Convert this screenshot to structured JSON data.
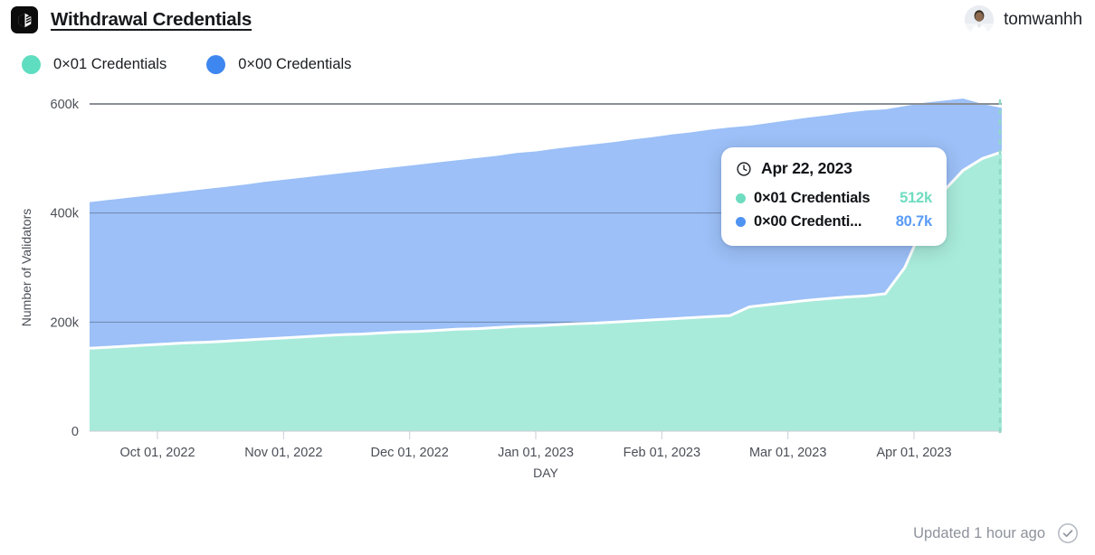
{
  "header": {
    "logo_icon": "cube-logo-icon",
    "title": "Withdrawal Credentials",
    "user": {
      "name": "tomwanhh",
      "avatar_icon": "user-avatar"
    }
  },
  "legend": {
    "items": [
      {
        "label": "0×01 Credentials",
        "color": "#5FDDC0",
        "icon": "legend-dot-icon"
      },
      {
        "label": "0×00 Credentials",
        "color": "#3E87F0",
        "icon": "legend-dot-icon"
      }
    ]
  },
  "tooltip": {
    "clock_icon": "clock-icon",
    "date": "Apr 22, 2023",
    "rows": [
      {
        "label": "0×01 Credentials",
        "value": "512k",
        "dot_color": "#6FDCC0",
        "value_color": "#6FDCC0"
      },
      {
        "label": "0×00 Credenti...",
        "value": "80.7k",
        "dot_color": "#4F93F3",
        "value_color": "#5B9CF5"
      }
    ]
  },
  "footer": {
    "updated_text": "Updated 1 hour ago",
    "status_icon": "check-circle-icon"
  },
  "chart_data": {
    "type": "area",
    "title": "Withdrawal Credentials",
    "xlabel": "DAY",
    "ylabel": "Number of Validators",
    "ylim": [
      0,
      600000
    ],
    "ytick_labels": [
      "0",
      "200k",
      "400k",
      "600k"
    ],
    "ytick_values": [
      0,
      200000,
      400000,
      600000
    ],
    "xtick_labels": [
      "Oct 01, 2022",
      "Nov 01, 2022",
      "Dec 01, 2022",
      "Jan 01, 2023",
      "Feb 01, 2023",
      "Mar 01, 2023",
      "Apr 01, 2023"
    ],
    "grid": true,
    "stacked": true,
    "legend_position": "top-left",
    "cursor": {
      "date": "Apr 22, 2023",
      "style": "dashed-vertical",
      "color": "#8FD9C6"
    },
    "x": [
      "2022-09-16",
      "2022-09-21",
      "2022-09-26",
      "2022-10-01",
      "2022-10-06",
      "2022-10-11",
      "2022-10-16",
      "2022-10-21",
      "2022-10-26",
      "2022-11-01",
      "2022-11-06",
      "2022-11-11",
      "2022-11-16",
      "2022-11-21",
      "2022-11-26",
      "2022-12-01",
      "2022-12-06",
      "2022-12-11",
      "2022-12-16",
      "2022-12-21",
      "2022-12-26",
      "2023-01-01",
      "2023-01-06",
      "2023-01-11",
      "2023-01-16",
      "2023-01-21",
      "2023-01-26",
      "2023-02-01",
      "2023-02-06",
      "2023-02-11",
      "2023-02-16",
      "2023-02-21",
      "2023-02-26",
      "2023-03-01",
      "2023-03-06",
      "2023-03-11",
      "2023-03-16",
      "2023-03-21",
      "2023-03-26",
      "2023-04-01",
      "2023-04-06",
      "2023-04-11",
      "2023-04-13",
      "2023-04-15",
      "2023-04-17",
      "2023-04-19",
      "2023-04-21",
      "2023-04-22"
    ],
    "series": [
      {
        "name": "0×01 Credentials",
        "color": "#A8EBDA",
        "values": [
          152000,
          154000,
          156000,
          158000,
          160000,
          162000,
          163000,
          165000,
          167000,
          169000,
          171000,
          173000,
          175000,
          177000,
          178000,
          180000,
          182000,
          183000,
          185000,
          187000,
          188000,
          190000,
          192000,
          193000,
          195000,
          197000,
          198000,
          200000,
          202000,
          204000,
          206000,
          208000,
          210000,
          212000,
          228000,
          232000,
          236000,
          240000,
          243000,
          246000,
          248000,
          252000,
          300000,
          380000,
          440000,
          478000,
          500000,
          512000
        ]
      },
      {
        "name": "0×00 Credentials",
        "color": "#9CC0F7",
        "values": [
          268000,
          270000,
          272000,
          274000,
          276000,
          278000,
          281000,
          283000,
          285000,
          288000,
          290000,
          292000,
          294000,
          296000,
          299000,
          301000,
          303000,
          306000,
          308000,
          310000,
          313000,
          315000,
          318000,
          320000,
          323000,
          325000,
          328000,
          330000,
          333000,
          335000,
          338000,
          340000,
          343000,
          345000,
          332000,
          333000,
          334000,
          335000,
          336000,
          338000,
          340000,
          338000,
          296000,
          222000,
          166000,
          132000,
          100000,
          80700
        ]
      }
    ]
  }
}
